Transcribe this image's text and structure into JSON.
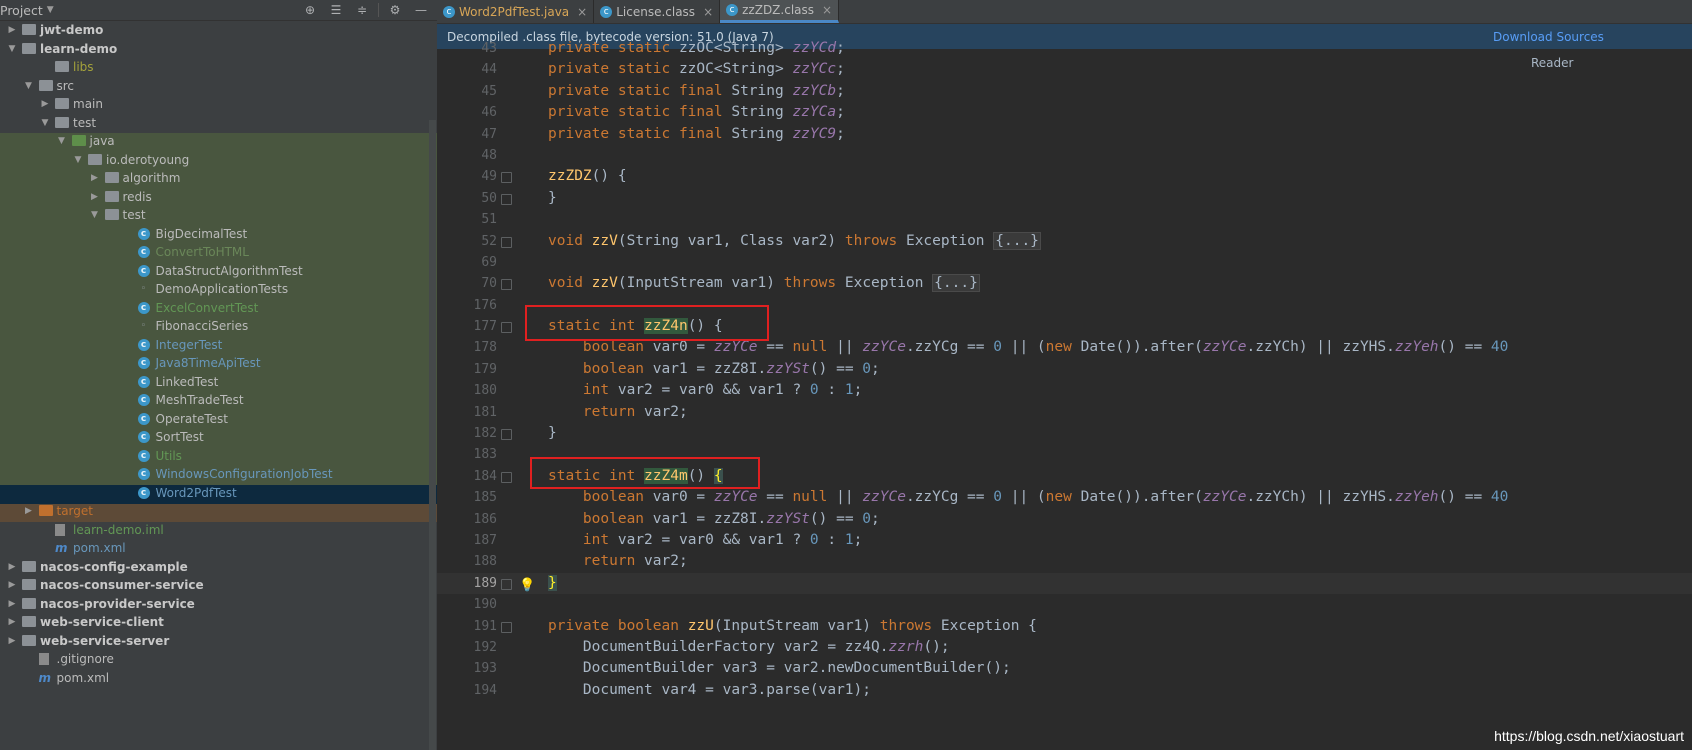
{
  "project_panel": {
    "title": "Project",
    "tools": [
      "globe-icon",
      "collapse-all-icon",
      "expand-icon",
      "gear-icon",
      "minimize-icon"
    ],
    "tree": [
      {
        "label": "jwt-demo",
        "depth": 0,
        "arrow": "▶",
        "kind": "folder",
        "bold": true
      },
      {
        "label": "learn-demo",
        "depth": 0,
        "arrow": "▼",
        "kind": "folder",
        "bold": true
      },
      {
        "label": "libs",
        "depth": 2,
        "arrow": "",
        "kind": "folder",
        "color": "#a4a23b"
      },
      {
        "label": "src",
        "depth": 1,
        "arrow": "▼",
        "kind": "folder"
      },
      {
        "label": "main",
        "depth": 2,
        "arrow": "▶",
        "kind": "folder"
      },
      {
        "label": "test",
        "depth": 2,
        "arrow": "▼",
        "kind": "folder"
      },
      {
        "label": "java",
        "depth": 3,
        "arrow": "▼",
        "kind": "folder-green"
      },
      {
        "label": "io.derotyoung",
        "depth": 4,
        "arrow": "▼",
        "kind": "pkg"
      },
      {
        "label": "algorithm",
        "depth": 5,
        "arrow": "▶",
        "kind": "pkg"
      },
      {
        "label": "redis",
        "depth": 5,
        "arrow": "▶",
        "kind": "pkg"
      },
      {
        "label": "test",
        "depth": 5,
        "arrow": "▼",
        "kind": "pkg"
      },
      {
        "label": "BigDecimalTest",
        "depth": 7,
        "kind": "class"
      },
      {
        "label": "ConvertToHTML",
        "depth": 7,
        "kind": "class",
        "color": "#6a8759"
      },
      {
        "label": "DataStructAlgorithmTest",
        "depth": 7,
        "kind": "class"
      },
      {
        "label": "DemoApplicationTests",
        "depth": 7,
        "kind": "class-plain"
      },
      {
        "label": "ExcelConvertTest",
        "depth": 7,
        "kind": "class",
        "color": "#629755"
      },
      {
        "label": "FibonacciSeries",
        "depth": 7,
        "kind": "class-plain"
      },
      {
        "label": "IntegerTest",
        "depth": 7,
        "kind": "class",
        "color": "#6897bb"
      },
      {
        "label": "Java8TimeApiTest",
        "depth": 7,
        "kind": "class",
        "color": "#6897bb"
      },
      {
        "label": "LinkedTest",
        "depth": 7,
        "kind": "class"
      },
      {
        "label": "MeshTradeTest",
        "depth": 7,
        "kind": "class"
      },
      {
        "label": "OperateTest",
        "depth": 7,
        "kind": "class"
      },
      {
        "label": "SortTest",
        "depth": 7,
        "kind": "class"
      },
      {
        "label": "Utils",
        "depth": 7,
        "kind": "class",
        "color": "#629755"
      },
      {
        "label": "WindowsConfigurationJobTest",
        "depth": 7,
        "kind": "class",
        "color": "#6897bb"
      },
      {
        "label": "Word2PdfTest",
        "depth": 7,
        "kind": "class",
        "color": "#6897bb",
        "selected": true
      },
      {
        "label": "target",
        "depth": 1,
        "arrow": "▶",
        "kind": "folder-orange",
        "color": "#c0702e"
      },
      {
        "label": "learn-demo.iml",
        "depth": 2,
        "kind": "file",
        "color": "#629755"
      },
      {
        "label": "pom.xml",
        "depth": 2,
        "kind": "mfile",
        "color": "#6897bb"
      },
      {
        "label": "nacos-config-example",
        "depth": 0,
        "arrow": "▶",
        "kind": "folder",
        "bold": true
      },
      {
        "label": "nacos-consumer-service",
        "depth": 0,
        "arrow": "▶",
        "kind": "folder",
        "bold": true
      },
      {
        "label": "nacos-provider-service",
        "depth": 0,
        "arrow": "▶",
        "kind": "folder",
        "bold": true
      },
      {
        "label": "web-service-client",
        "depth": 0,
        "arrow": "▶",
        "kind": "folder",
        "bold": true
      },
      {
        "label": "web-service-server",
        "depth": 0,
        "arrow": "▶",
        "kind": "folder",
        "bold": true
      },
      {
        "label": ".gitignore",
        "depth": 1,
        "kind": "file"
      },
      {
        "label": "pom.xml",
        "depth": 1,
        "kind": "mfile"
      }
    ]
  },
  "tabs": [
    {
      "label": "Word2PdfTest.java",
      "active": false,
      "orange": true
    },
    {
      "label": "License.class",
      "active": false,
      "orange": false
    },
    {
      "label": "zzZDZ.class",
      "active": true,
      "orange": false
    }
  ],
  "banner": {
    "info": "Decompiled .class file, bytecode version: 51.0 (Java 7)",
    "download": "Download Sources",
    "reader": "Reader"
  },
  "code_lines": [
    {
      "n": "43",
      "html": "<span class='kw'>private static</span> zzOC&lt;String&gt; <span class='it'>zzYCd</span>;"
    },
    {
      "n": "44",
      "html": "<span class='kw'>private static</span> zzOC&lt;String&gt; <span class='it'>zzYCc</span>;"
    },
    {
      "n": "45",
      "html": "<span class='kw'>private static final</span> String <span class='it'>zzYCb</span>;"
    },
    {
      "n": "46",
      "html": "<span class='kw'>private static final</span> String <span class='it'>zzYCa</span>;"
    },
    {
      "n": "47",
      "html": "<span class='kw'>private static final</span> String <span class='it'>zzYC9</span>;"
    },
    {
      "n": "48",
      "html": ""
    },
    {
      "n": "49",
      "html": "<span class='fn'>zzZDZ</span>() {",
      "fold": true
    },
    {
      "n": "50",
      "html": "}",
      "fold": true
    },
    {
      "n": "51",
      "html": ""
    },
    {
      "n": "52",
      "html": "<span class='kw'>void</span> <span class='fn'>zzV</span>(String var1, Class var2) <span class='kw'>throws</span> Exception <span class='fold-ph'>{...}</span>",
      "fold": true
    },
    {
      "n": "69",
      "html": ""
    },
    {
      "n": "70",
      "html": "<span class='kw'>void</span> <span class='fn'>zzV</span>(InputStream var1) <span class='kw'>throws</span> Exception <span class='fold-ph'>{...}</span>",
      "fold": true
    },
    {
      "n": "176",
      "html": ""
    },
    {
      "n": "177",
      "html": "<span class='kw'>static int</span> <span class='gm'>zzZ4n</span>() {",
      "fold": true
    },
    {
      "n": "178",
      "html": "    <span class='kw'>boolean</span> var0 = <span class='it'>zzYCe</span> == <span class='kw'>null</span> || <span class='it'>zzYCe</span>.zzYCg == <span class='num'>0</span> || (<span class='kw'>new</span> Date()).after(<span class='it'>zzYCe</span>.zzYCh) || zzYHS.<span class='it'>zzYeh</span>() == <span class='num'>40</span>"
    },
    {
      "n": "179",
      "html": "    <span class='kw'>boolean</span> var1 = zzZ8I.<span class='it'>zzYSt</span>() == <span class='num'>0</span>;"
    },
    {
      "n": "180",
      "html": "    <span class='kw'>int</span> var2 = var0 &amp;&amp; var1 ? <span class='num'>0</span> : <span class='num'>1</span>;"
    },
    {
      "n": "181",
      "html": "    <span class='kw'>return</span> var2;"
    },
    {
      "n": "182",
      "html": "}",
      "fold": true
    },
    {
      "n": "183",
      "html": ""
    },
    {
      "n": "184",
      "html": "<span class='kw'>static int</span> <span class='gm'>zzZ4m</span>() <span class='brace-hl'>{</span>",
      "fold": true
    },
    {
      "n": "185",
      "html": "    <span class='kw'>boolean</span> var0 = <span class='it'>zzYCe</span> == <span class='kw'>null</span> || <span class='it'>zzYCe</span>.zzYCg == <span class='num'>0</span> || (<span class='kw'>new</span> Date()).after(<span class='it'>zzYCe</span>.zzYCh) || zzYHS.<span class='it'>zzYeh</span>() == <span class='num'>40</span>"
    },
    {
      "n": "186",
      "html": "    <span class='kw'>boolean</span> var1 = zzZ8I.<span class='it'>zzYSt</span>() == <span class='num'>0</span>;"
    },
    {
      "n": "187",
      "html": "    <span class='kw'>int</span> var2 = var0 &amp;&amp; var1 ? <span class='num'>0</span> : <span class='num'>1</span>;"
    },
    {
      "n": "188",
      "html": "    <span class='kw'>return</span> var2;"
    },
    {
      "n": "189",
      "html": "<span class='brace-hl'>}</span>",
      "fold": true,
      "caret": true,
      "bulb": true
    },
    {
      "n": "190",
      "html": ""
    },
    {
      "n": "191",
      "html": "<span class='kw'>private boolean</span> <span class='fn'>zzU</span>(InputStream var1) <span class='kw'>throws</span> Exception {",
      "fold": true
    },
    {
      "n": "192",
      "html": "    DocumentBuilderFactory var2 = zz4Q.<span class='it'>zzrh</span>();"
    },
    {
      "n": "193",
      "html": "    DocumentBuilder var3 = var2.newDocumentBuilder();"
    },
    {
      "n": "194",
      "html": "    Document var4 = var3.parse(var1);"
    }
  ],
  "watermark": "https://blog.csdn.net/xiaostuart"
}
